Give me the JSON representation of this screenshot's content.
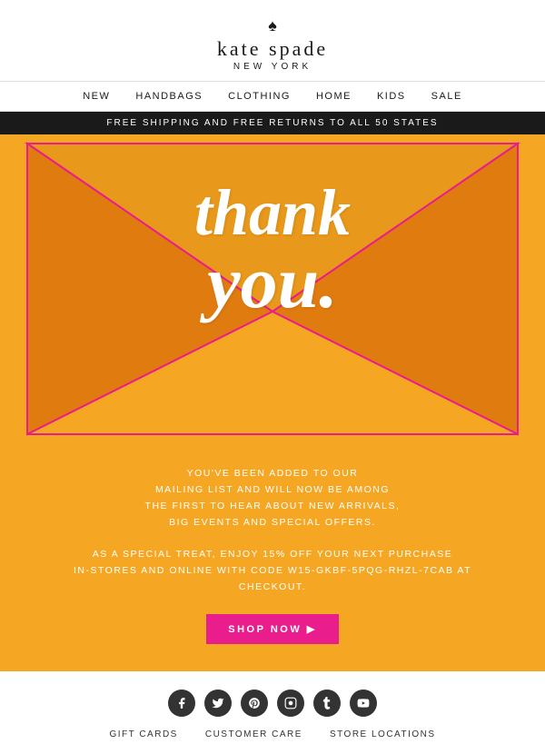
{
  "header": {
    "spade_symbol": "♠",
    "brand_name": "kate spade",
    "brand_city": "NEW YORK"
  },
  "nav": {
    "items": [
      {
        "label": "NEW"
      },
      {
        "label": "HANDBAGS"
      },
      {
        "label": "CLOTHING"
      },
      {
        "label": "HOME"
      },
      {
        "label": "KIDS"
      },
      {
        "label": "SALE"
      }
    ]
  },
  "banner": {
    "text": "FREE SHIPPING AND FREE RETURNS TO ALL 50 STATES"
  },
  "envelope": {
    "thank_line1": "thank",
    "thank_line2": "you.",
    "mailing_text": "YOU'VE BEEN ADDED TO OUR\nMAILING LIST AND WILL NOW BE AMONG\nTHE FIRST TO HEAR ABOUT NEW ARRIVALS,\nBIG EVENTS AND SPECIAL OFFERS.",
    "offer_text": "AS A SPECIAL TREAT, ENJOY 15% OFF YOUR NEXT PURCHASE\nIN-STORES AND ONLINE WITH CODE W15-GKBF-5PQG-RHZL-7CAB AT\nCHECKOUT.",
    "cta_label": "SHOP NOW ▶",
    "accent_color": "#e91e8c",
    "bg_color": "#f5a623"
  },
  "footer": {
    "social": [
      {
        "name": "facebook",
        "icon": "f"
      },
      {
        "name": "twitter",
        "icon": "t"
      },
      {
        "name": "pinterest",
        "icon": "p"
      },
      {
        "name": "instagram",
        "icon": "i"
      },
      {
        "name": "tumblr",
        "icon": "t"
      },
      {
        "name": "youtube",
        "icon": "y"
      }
    ],
    "links": [
      {
        "label": "GIFT CARDS"
      },
      {
        "label": "CUSTOMER CARE"
      },
      {
        "label": "STORE LOCATIONS"
      }
    ]
  }
}
